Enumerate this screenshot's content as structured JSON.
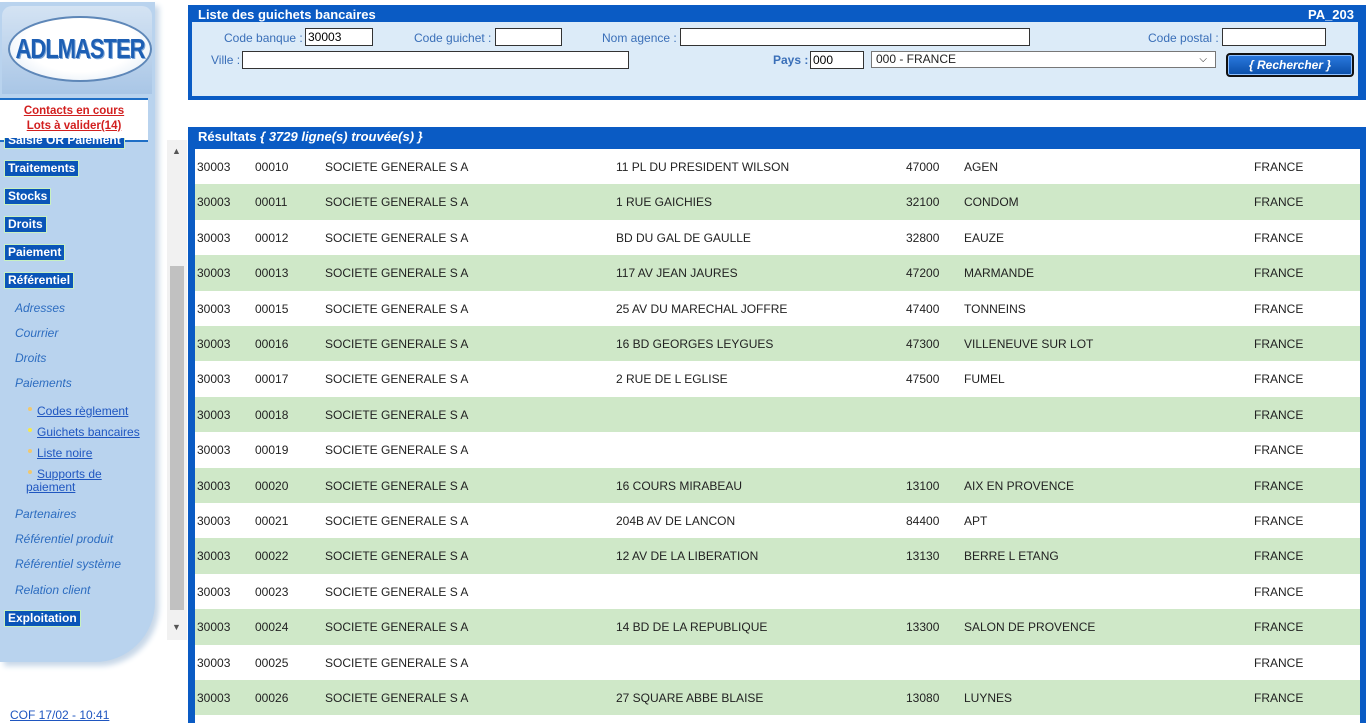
{
  "sidebar": {
    "logo_text": "ADLMASTER",
    "alerts": [
      "Contacts en cours",
      "Lots à valider(14)"
    ],
    "top_partial": "Saisie OR Paiement",
    "menu_top": [
      "Traitements",
      "Stocks",
      "Droits",
      "Paiement",
      "Référentiel"
    ],
    "ref_sub": [
      "Adresses",
      "Courrier",
      "Droits",
      "Paiements"
    ],
    "leaves": [
      "Codes règlement",
      "Guichets bancaires",
      "Liste noire",
      "Supports de paiement"
    ],
    "ref_sub2": [
      "Partenaires",
      "Référentiel produit",
      "Référentiel système",
      "Relation client"
    ],
    "exploitation": "Exploitation",
    "footer": "COF 17/02 - 10:41"
  },
  "search": {
    "title": "Liste des guichets bancaires",
    "code": "PA_203",
    "labels": {
      "code_banque": "Code banque :",
      "code_guichet": "Code guichet :",
      "nom_agence": "Nom agence :",
      "code_postal": "Code postal :",
      "ville": "Ville :",
      "pays": "Pays :"
    },
    "values": {
      "code_banque": "30003",
      "code_guichet": "",
      "nom_agence": "",
      "code_postal": "",
      "ville": "",
      "pays": "000"
    },
    "country_selected": "000 - FRANCE",
    "button": "{ Rechercher }"
  },
  "results": {
    "title": "Résultats",
    "count_text": "{ 3729 ligne(s) trouvée(s) }",
    "rows": [
      [
        "30003",
        "00010",
        "SOCIETE GENERALE S A",
        "11 PL DU PRESIDENT WILSON",
        "47000",
        "AGEN",
        "FRANCE"
      ],
      [
        "30003",
        "00011",
        "SOCIETE GENERALE S A",
        "1 RUE GAICHIES",
        "32100",
        "CONDOM",
        "FRANCE"
      ],
      [
        "30003",
        "00012",
        "SOCIETE GENERALE S A",
        "BD DU GAL DE GAULLE",
        "32800",
        "EAUZE",
        "FRANCE"
      ],
      [
        "30003",
        "00013",
        "SOCIETE GENERALE S A",
        "117 AV JEAN JAURES",
        "47200",
        "MARMANDE",
        "FRANCE"
      ],
      [
        "30003",
        "00015",
        "SOCIETE GENERALE S A",
        "25 AV DU MARECHAL JOFFRE",
        "47400",
        "TONNEINS",
        "FRANCE"
      ],
      [
        "30003",
        "00016",
        "SOCIETE GENERALE S A",
        "16 BD GEORGES LEYGUES",
        "47300",
        "VILLENEUVE SUR LOT",
        "FRANCE"
      ],
      [
        "30003",
        "00017",
        "SOCIETE GENERALE S A",
        "2 RUE DE L EGLISE",
        "47500",
        "FUMEL",
        "FRANCE"
      ],
      [
        "30003",
        "00018",
        "SOCIETE GENERALE S A",
        "",
        "",
        "",
        "FRANCE"
      ],
      [
        "30003",
        "00019",
        "SOCIETE GENERALE S A",
        "",
        "",
        "",
        "FRANCE"
      ],
      [
        "30003",
        "00020",
        "SOCIETE GENERALE S A",
        "16 COURS MIRABEAU",
        "13100",
        "AIX EN PROVENCE",
        "FRANCE"
      ],
      [
        "30003",
        "00021",
        "SOCIETE GENERALE S A",
        "204B AV DE LANCON",
        "84400",
        "APT",
        "FRANCE"
      ],
      [
        "30003",
        "00022",
        "SOCIETE GENERALE S A",
        "12 AV DE LA LIBERATION",
        "13130",
        "BERRE L ETANG",
        "FRANCE"
      ],
      [
        "30003",
        "00023",
        "SOCIETE GENERALE S A",
        "",
        "",
        "",
        "FRANCE"
      ],
      [
        "30003",
        "00024",
        "SOCIETE GENERALE S A",
        "14 BD DE LA REPUBLIQUE",
        "13300",
        "SALON DE PROVENCE",
        "FRANCE"
      ],
      [
        "30003",
        "00025",
        "SOCIETE GENERALE S A",
        "",
        "",
        "",
        "FRANCE"
      ],
      [
        "30003",
        "00026",
        "SOCIETE GENERALE S A",
        "27 SQUARE ABBE BLAISE",
        "13080",
        "LUYNES",
        "FRANCE"
      ]
    ]
  },
  "colors": {
    "accent": "#0a5bc4",
    "row_alt": "#cfe8c8",
    "alert": "#d21f1f"
  }
}
